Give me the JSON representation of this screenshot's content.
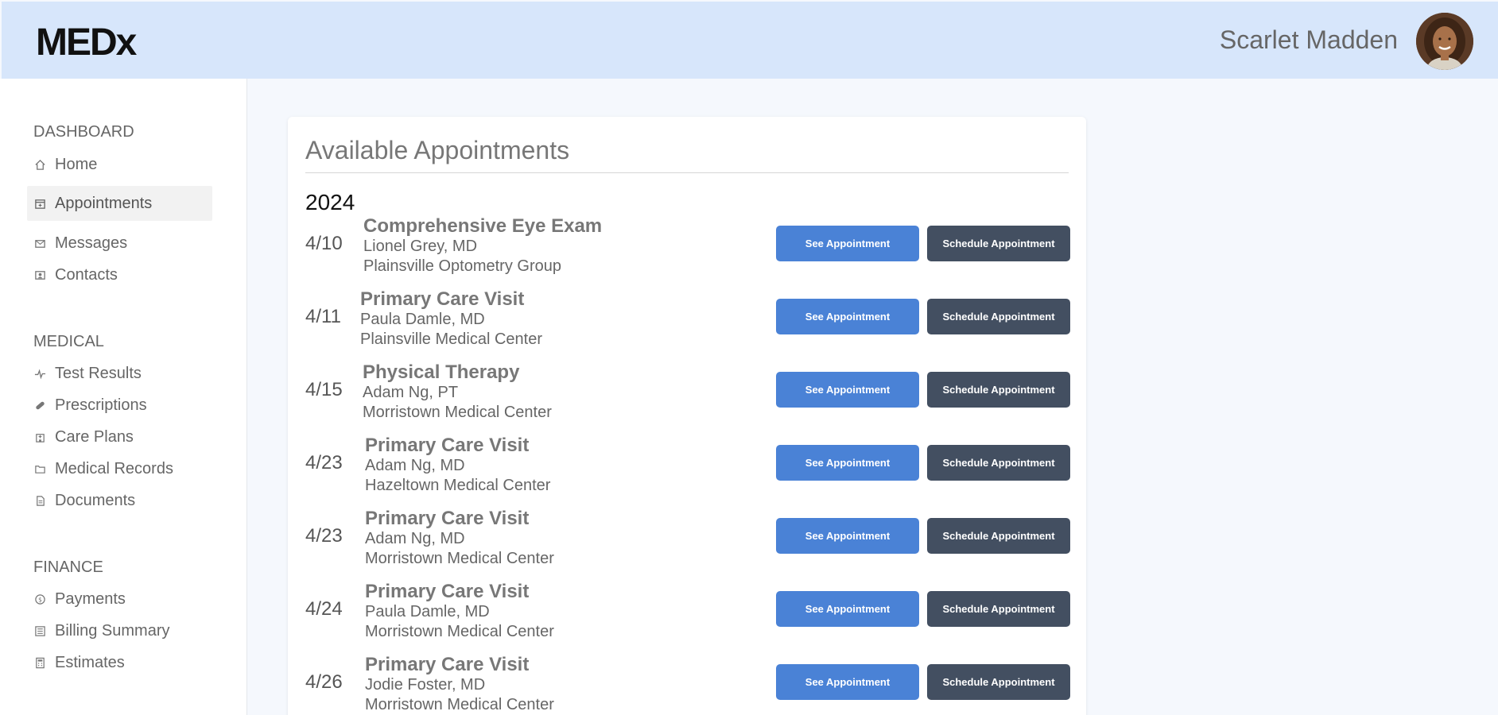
{
  "header": {
    "logo": "MEDx",
    "user_name": "Scarlet Madden"
  },
  "sidebar": {
    "sections": [
      {
        "title": "DASHBOARD",
        "items": [
          {
            "label": "Home",
            "icon": "home-icon"
          },
          {
            "label": "Appointments",
            "icon": "calendar-icon",
            "active": true
          },
          {
            "label": "Messages",
            "icon": "envelope-icon"
          },
          {
            "label": "Contacts",
            "icon": "contact-card-icon"
          }
        ]
      },
      {
        "title": "MEDICAL",
        "items": [
          {
            "label": "Test Results",
            "icon": "pulse-icon"
          },
          {
            "label": "Prescriptions",
            "icon": "pill-icon"
          },
          {
            "label": "Care Plans",
            "icon": "hospital-icon"
          },
          {
            "label": "Medical Records",
            "icon": "folder-icon"
          },
          {
            "label": "Documents",
            "icon": "document-icon"
          }
        ]
      },
      {
        "title": "FINANCE",
        "items": [
          {
            "label": "Payments",
            "icon": "dollar-circle-icon"
          },
          {
            "label": "Billing Summary",
            "icon": "billing-icon"
          },
          {
            "label": "Estimates",
            "icon": "calculator-icon"
          }
        ]
      }
    ]
  },
  "main": {
    "title": "Available Appointments",
    "year": "2024",
    "see_label": "See Appointment",
    "schedule_label": "Schedule Appointment",
    "appointments": [
      {
        "date": "4/10",
        "title": "Comprehensive Eye Exam",
        "provider": "Lionel Grey, MD",
        "location": "Plainsville Optometry Group"
      },
      {
        "date": "4/11",
        "title": "Primary Care Visit",
        "provider": "Paula Damle, MD",
        "location": "Plainsville Medical Center"
      },
      {
        "date": "4/15",
        "title": "Physical Therapy",
        "provider": "Adam Ng, PT",
        "location": "Morristown Medical Center"
      },
      {
        "date": "4/23",
        "title": "Primary Care Visit",
        "provider": "Adam Ng, MD",
        "location": "Hazeltown Medical Center"
      },
      {
        "date": "4/23",
        "title": "Primary Care Visit",
        "provider": "Adam Ng, MD",
        "location": "Morristown Medical Center"
      },
      {
        "date": "4/24",
        "title": "Primary Care Visit",
        "provider": "Paula Damle, MD",
        "location": "Morristown Medical Center"
      },
      {
        "date": "4/26",
        "title": "Primary Care Visit",
        "provider": "Jodie Foster, MD",
        "location": "Morristown Medical Center"
      }
    ]
  },
  "colors": {
    "header_bg": "#d7e6fb",
    "primary_button": "#4a82d6",
    "secondary_button": "#434f61"
  }
}
